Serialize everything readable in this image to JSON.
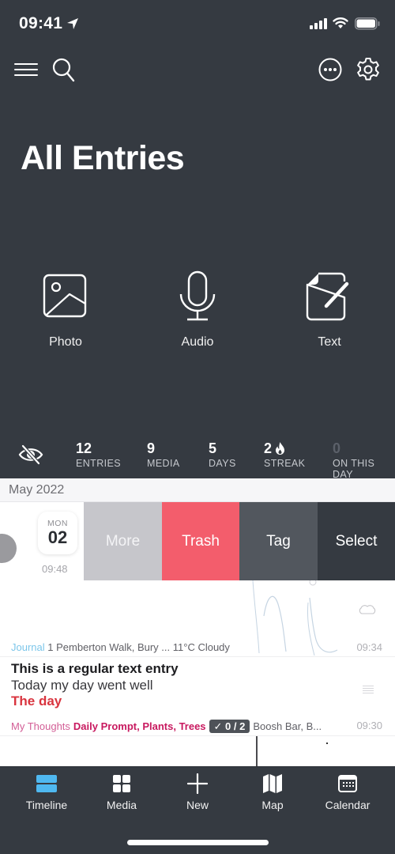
{
  "status_bar": {
    "time": "09:41",
    "icons": [
      "location-arrow-icon",
      "cellular-signal-icon",
      "wifi-icon",
      "battery-icon"
    ]
  },
  "top_nav": {
    "icons": [
      "hamburger-menu-icon",
      "search-icon",
      "more-options-icon",
      "settings-gear-icon"
    ]
  },
  "page": {
    "title": "All Entries"
  },
  "quick_actions": [
    {
      "label": "Photo",
      "icon": "photo-icon"
    },
    {
      "label": "Audio",
      "icon": "microphone-icon"
    },
    {
      "label": "Text",
      "icon": "edit-document-icon"
    }
  ],
  "stats": {
    "hide_icon": "eye-slash-icon",
    "items": [
      {
        "value": "12",
        "label": "ENTRIES"
      },
      {
        "value": "9",
        "label": "MEDIA"
      },
      {
        "value": "5",
        "label": "DAYS"
      },
      {
        "value": "2",
        "label": "STREAK",
        "icon": "flame-icon"
      },
      {
        "value": "0",
        "label": "ON THIS DAY"
      }
    ]
  },
  "timeline": {
    "month_header": "May 2022",
    "swiped_entry": {
      "day_of_week": "MON",
      "day": "02",
      "time": "09:48",
      "actions": [
        {
          "label": "More",
          "color": "#c6c6cb"
        },
        {
          "label": "Trash",
          "color": "#f35d6c"
        },
        {
          "label": "Tag",
          "color": "#52575e"
        },
        {
          "label": "Select",
          "color": "#353a41"
        }
      ]
    },
    "entries": [
      {
        "type": "drawing",
        "journal": "Journal",
        "journal_color": "#7cc6ea",
        "location": "1 Pemberton Walk, Bury ...",
        "weather": "11°C Cloudy",
        "weather_icon": "cloud-icon",
        "time": "09:34"
      },
      {
        "type": "text",
        "title": "This is a regular text entry",
        "body": "Today my day went well",
        "highlight": "The day",
        "journal": "My Thoughts",
        "journal_color": "#d35e96",
        "tags": "Daily Prompt, Plants, Trees",
        "todo": "✓ 0 / 2",
        "location": "Boosh Bar, B...",
        "time": "09:30",
        "icon": "text-lines-icon"
      }
    ]
  },
  "tab_bar": {
    "accent": "#4fb8f0",
    "tabs": [
      {
        "label": "Timeline",
        "icon": "timeline-icon",
        "active": true
      },
      {
        "label": "Media",
        "icon": "media-grid-icon",
        "active": false
      },
      {
        "label": "New",
        "icon": "plus-icon",
        "active": false
      },
      {
        "label": "Map",
        "icon": "map-icon",
        "active": false
      },
      {
        "label": "Calendar",
        "icon": "calendar-icon",
        "active": false
      }
    ]
  }
}
